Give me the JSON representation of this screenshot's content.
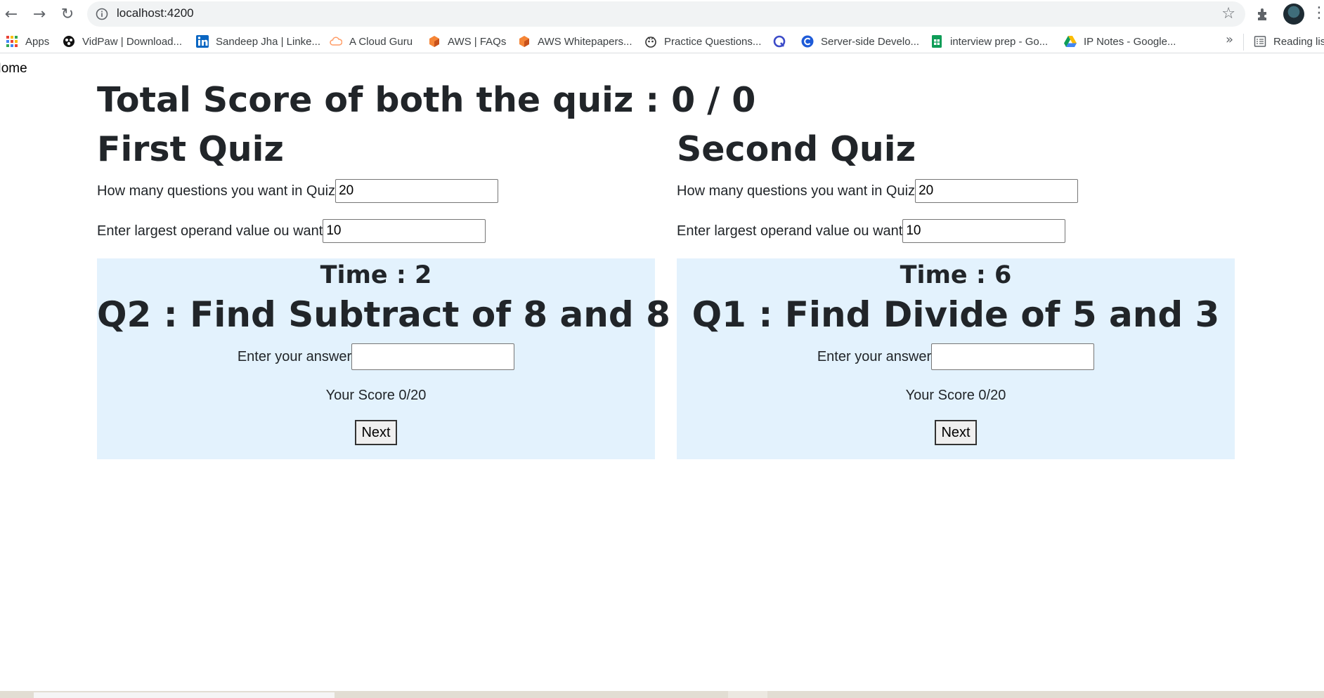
{
  "browser": {
    "url": "localhost:4200",
    "bookmarks": [
      {
        "label": "Apps",
        "icon": "apps-grid-icon"
      },
      {
        "label": "VidPaw | Download...",
        "icon": "vidpaw-icon"
      },
      {
        "label": "Sandeep Jha | Linke...",
        "icon": "linkedin-icon"
      },
      {
        "label": "A Cloud Guru",
        "icon": "cloud-icon"
      },
      {
        "label": "AWS | FAQs",
        "icon": "aws-cube-icon"
      },
      {
        "label": "AWS Whitepapers...",
        "icon": "aws-cube-icon"
      },
      {
        "label": "Practice Questions...",
        "icon": "practice-icon"
      },
      {
        "label": "",
        "icon": "q-logo-icon"
      },
      {
        "label": "Server-side Develo...",
        "icon": "c-logo-icon"
      },
      {
        "label": "interview prep - Go...",
        "icon": "sheets-icon"
      },
      {
        "label": "IP Notes - Google...",
        "icon": "drive-icon"
      }
    ],
    "reading_list": "Reading list",
    "more": "»"
  },
  "page": {
    "home_link": "Home",
    "total_score": "Total Score of both the quiz : 0 / 0"
  },
  "quizzes": [
    {
      "title": "First Quiz",
      "questions_label": "How many questions you want in Quiz",
      "questions_value": "20",
      "operand_label": "Enter largest operand value ou want",
      "operand_value": "10",
      "time": "Time : 2",
      "question": "Q2 : Find Subtract of 8 and 8",
      "answer_label": "Enter your answer",
      "answer_value": "",
      "score": "Your Score 0/20",
      "next_label": "Next"
    },
    {
      "title": "Second Quiz",
      "questions_label": "How many questions you want in Quiz",
      "questions_value": "20",
      "operand_label": "Enter largest operand value ou want",
      "operand_value": "10",
      "time": "Time : 6",
      "question": "Q1 : Find Divide of 5 and 3",
      "answer_label": "Enter your answer",
      "answer_value": "",
      "score": "Your Score 0/20",
      "next_label": "Next"
    }
  ],
  "colors": {
    "panel_bg": "#e3f2fd",
    "text": "#212529"
  }
}
